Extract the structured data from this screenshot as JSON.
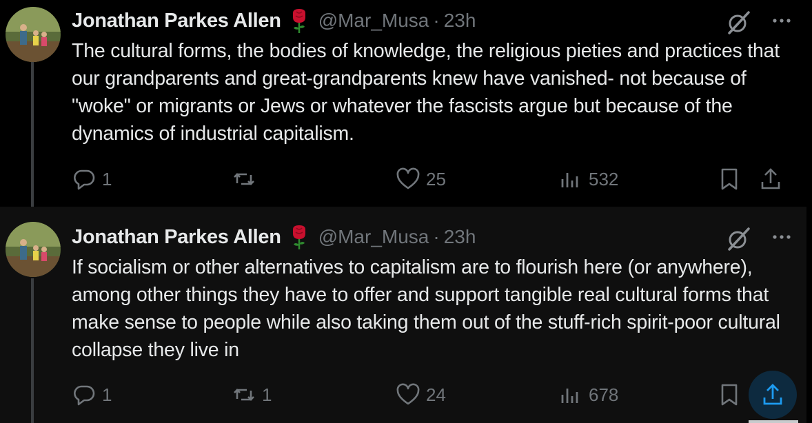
{
  "tweets": [
    {
      "author_name": "Jonathan Parkes Allen",
      "handle": "@Mar_Musa",
      "separator": "·",
      "time": "23h",
      "text": "The cultural forms, the bodies of knowledge, the religious pieties and practices that our grandparents and great-grandparents knew have vanished- not because of \"woke\" or migrants or Jews or whatever the fascists argue but because of the dynamics of industrial capitalism.",
      "replies": "1",
      "retweets": "",
      "likes": "25",
      "views": "532"
    },
    {
      "author_name": "Jonathan Parkes Allen",
      "handle": "@Mar_Musa",
      "separator": "·",
      "time": "23h",
      "text": "If socialism or other alternatives to capitalism are to flourish here (or anywhere), among other things they have to offer and support tangible real cultural forms that make sense to people while also taking them out of the stuff-rich spirit-poor cultural collapse they live in",
      "replies": "1",
      "retweets": "1",
      "likes": "24",
      "views": "678"
    }
  ],
  "icons": [
    "reply-icon",
    "retweet-icon",
    "like-icon",
    "views-icon",
    "bookmark-icon",
    "share-icon",
    "grok-icon",
    "more-icon",
    "rose-icon"
  ],
  "colors": {
    "background": "#000000",
    "text": "#e7e9ea",
    "muted": "#71767b",
    "accent": "#1d9bf0",
    "rose": "#c8102e"
  }
}
